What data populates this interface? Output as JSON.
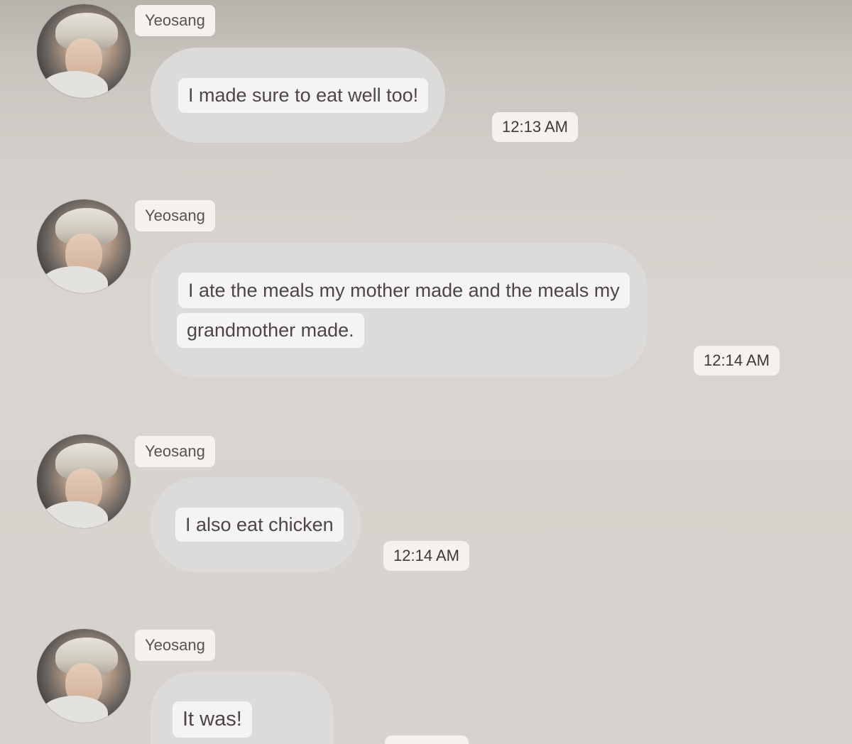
{
  "messages": [
    {
      "sender": "Yeosang",
      "lines": [
        "I made sure to eat well too!"
      ],
      "time": "12:13 AM"
    },
    {
      "sender": "Yeosang",
      "lines": [
        "I ate the meals my mother made and the meals my",
        "grandmother made."
      ],
      "time": "12:14 AM"
    },
    {
      "sender": "Yeosang",
      "lines": [
        "I also eat chicken"
      ],
      "time": "12:14 AM"
    },
    {
      "sender": "Yeosang",
      "lines": [
        "It was!"
      ],
      "time": ""
    }
  ]
}
